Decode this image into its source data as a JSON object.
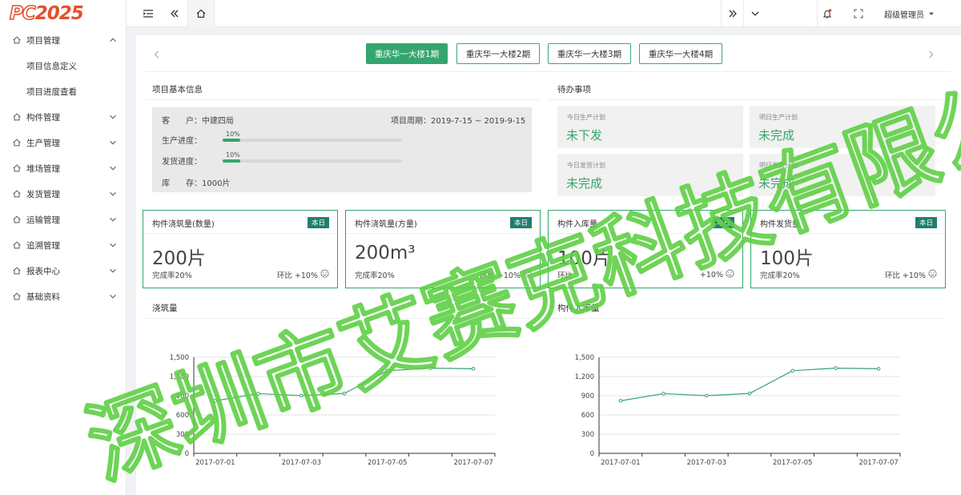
{
  "app": {
    "logo_outline": "PC",
    "logo_fill": "2025"
  },
  "sidebar": {
    "items": [
      {
        "label": "项目管理",
        "icon": "home-icon",
        "expanded": true,
        "children": [
          {
            "label": "项目信息定义"
          },
          {
            "label": "项目进度查看"
          }
        ]
      },
      {
        "label": "构件管理",
        "icon": "home-icon"
      },
      {
        "label": "生产管理",
        "icon": "home-icon"
      },
      {
        "label": "堆场管理",
        "icon": "home-icon"
      },
      {
        "label": "发货管理",
        "icon": "home-icon"
      },
      {
        "label": "运输管理",
        "icon": "home-icon"
      },
      {
        "label": "追溯管理",
        "icon": "home-icon"
      },
      {
        "label": "报表中心",
        "icon": "home-icon"
      },
      {
        "label": "基础资料",
        "icon": "home-icon"
      }
    ]
  },
  "topbar": {
    "user": "超级管理员"
  },
  "periods": [
    "重庆华一大楼1期",
    "重庆华一大楼2期",
    "重庆华一大楼3期",
    "重庆华一大楼4期"
  ],
  "active_period": 0,
  "basic": {
    "title": "项目基本信息",
    "customer_label": "客　　户：",
    "customer_value": "中建四局",
    "cycle_label": "项目周期：",
    "cycle_value": "2019-7-15 ~ 2019-9-15",
    "production_label": "生产进度：",
    "production_pct": "10%",
    "production_value": 0.1,
    "shipping_label": "发货进度：",
    "shipping_pct": "10%",
    "shipping_value": 0.1,
    "stock_label": "库　　存：",
    "stock_value": "1000片"
  },
  "todo": {
    "title": "待办事项",
    "items": [
      {
        "label": "今日生产计划",
        "value": "未下发"
      },
      {
        "label": "明日生产计划",
        "value": "未完成"
      },
      {
        "label": "今日发货计划",
        "value": "未完成"
      },
      {
        "label": "明日发货计划",
        "value": "未完成"
      }
    ]
  },
  "kpis": [
    {
      "title": "构件浇筑量(数量)",
      "badge": "本日",
      "value": "200片",
      "footer_left": "完成率20%",
      "footer_right": "环比 +10%"
    },
    {
      "title": "构件浇筑量(方量)",
      "badge": "本日",
      "value": "200m³",
      "footer_left": "完成率20%",
      "footer_right": "环比 +10%"
    },
    {
      "title": "构件入库量",
      "badge": "本日",
      "value": "100片",
      "footer_left": "环比",
      "footer_right": "+10%"
    },
    {
      "title": "构件发货量",
      "badge": "本日",
      "value": "100片",
      "footer_left": "完成率20%",
      "footer_right": "环比 +10%"
    }
  ],
  "chart_titles": [
    "浇筑量",
    "构件入库量"
  ],
  "chart_data": [
    {
      "type": "line",
      "title": "浇筑量",
      "x": [
        "2017-07-01",
        "2017-07-02",
        "2017-07-03",
        "2017-07-04",
        "2017-07-05",
        "2017-07-06",
        "2017-07-07"
      ],
      "x_tick_labels": [
        "2017-07-01",
        "2017-07-03",
        "2017-07-05",
        "2017-07-07"
      ],
      "values": [
        820,
        932,
        901,
        934,
        1290,
        1330,
        1320
      ],
      "ylim": [
        0,
        1500
      ],
      "y_ticks": [
        "0",
        "300",
        "600",
        "900",
        "1,200",
        "1,500"
      ],
      "grid": true,
      "color": "#35a56f"
    },
    {
      "type": "line",
      "title": "构件入库量",
      "x": [
        "2017-07-01",
        "2017-07-02",
        "2017-07-03",
        "2017-07-04",
        "2017-07-05",
        "2017-07-06",
        "2017-07-07"
      ],
      "x_tick_labels": [
        "2017-07-01",
        "2017-07-03",
        "2017-07-05",
        "2017-07-07"
      ],
      "values": [
        820,
        932,
        901,
        934,
        1290,
        1330,
        1320
      ],
      "ylim": [
        0,
        1500
      ],
      "y_ticks": [
        "0",
        "300",
        "600",
        "900",
        "1,200",
        "1,500"
      ],
      "grid": true,
      "color": "#35a56f"
    }
  ],
  "watermark": "深圳市艾赛克科技有限公司",
  "colors": {
    "accent": "#35a56f",
    "badge": "#1f7f6e",
    "logo": "#e2502a"
  }
}
